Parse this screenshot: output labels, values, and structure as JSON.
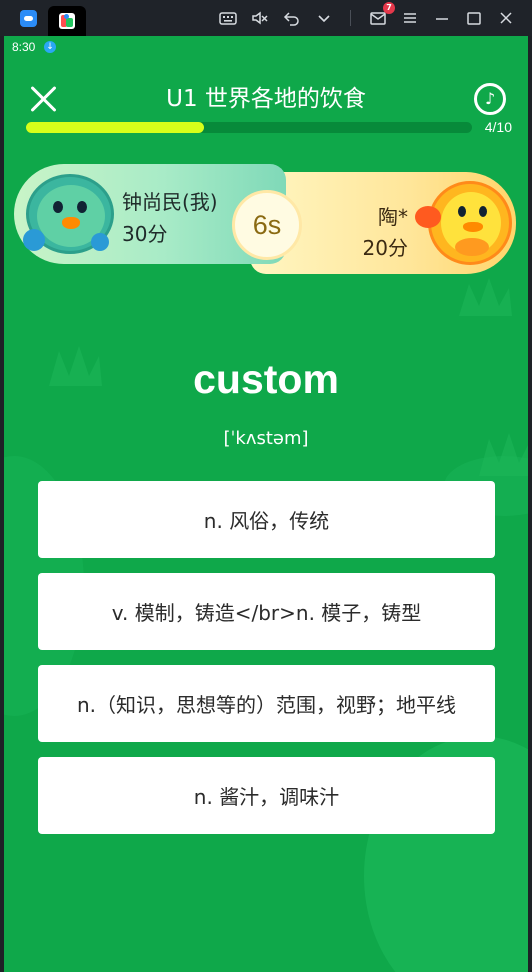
{
  "emulator": {
    "mail_badge": "7",
    "icons": [
      "app-logo",
      "keyboard-icon",
      "mute-icon",
      "undo-icon",
      "chevron-down-icon",
      "mail-icon",
      "menu-icon",
      "minimize-icon",
      "maximize-icon",
      "close-icon"
    ]
  },
  "status_bar": {
    "time": "8:30"
  },
  "header": {
    "title": "U1 世界各地的饮食",
    "progress_text": "4/10",
    "progress_fraction": 0.4
  },
  "battle": {
    "player": {
      "name": "钟尚民(我)",
      "score": "30分"
    },
    "opponent": {
      "name": "陶*",
      "score": "20分"
    },
    "timer": "6s"
  },
  "question": {
    "word": "custom",
    "phonetic": "[ˈkʌstəm]"
  },
  "options": [
    {
      "label": "n. 风俗，传统"
    },
    {
      "label": "v. 模制，铸造</br>n. 模子，铸型"
    },
    {
      "label": "n.（知识，思想等的）范围，视野；地平线"
    },
    {
      "label": "n. 酱汁，调味汁"
    }
  ],
  "colors": {
    "background": "#0fa84a",
    "progress_fill": "#d7ff1a",
    "option_bg": "#ffffff"
  }
}
